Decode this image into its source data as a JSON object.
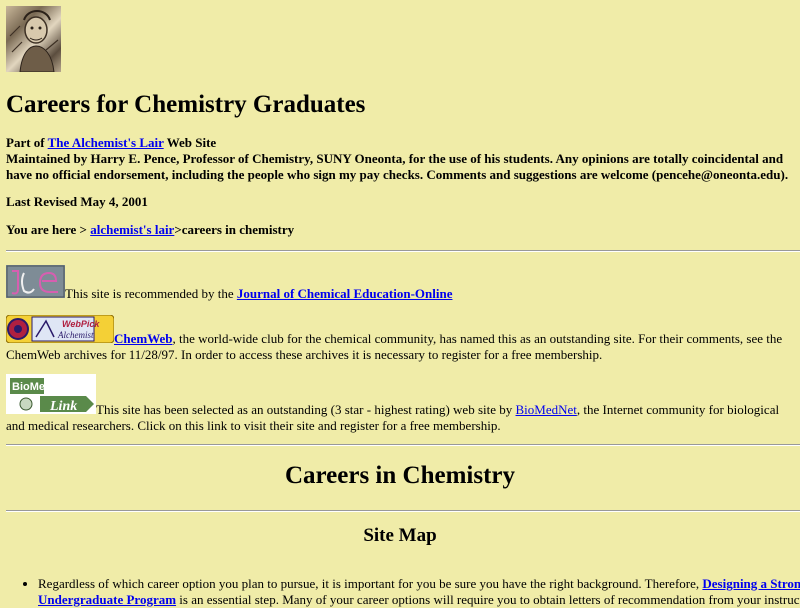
{
  "page": {
    "title": "Careers for Chemistry Graduates",
    "part_of_prefix": "Part of ",
    "site_link": "The Alchemist's Lair",
    "part_of_suffix": " Web Site",
    "maintained_by": "Maintained by Harry E. Pence, Professor of Chemistry, SUNY Oneonta, for the use of his students. Any opinions are totally coincidental and have no official endorsement, including the people who sign my pay checks. Comments and suggestions are welcome (pencehe@oneonta.edu).",
    "last_revised": "Last Revised May 4, 2001",
    "breadcrumb_prefix": "You are here > ",
    "breadcrumb_link": "alchemist's lair",
    "breadcrumb_suffix": ">careers in chemistry"
  },
  "recommendations": {
    "jce_text": "This site is recommended by the ",
    "jce_link": "Journal of Chemical Education-Online",
    "jce_badge": "JCE",
    "chemweb_badge_left": "WebPick",
    "chemweb_badge_right": "Alchemist",
    "chemweb_link": "ChemWeb",
    "chemweb_text": ", the world-wide club for the chemical community, has named this as an outstanding site. For their comments, see the ChemWeb archives for 11/28/97. In order to access these archives it is necessary to register for a free membership.",
    "biomed_badge_top": "BioMed",
    "biomed_badge_bottom": "Link",
    "biomed_text_pre": "This site has been selected as an outstanding (3 star - highest rating) web site by ",
    "biomed_link": "BioMedNet",
    "biomed_text_post": ", the Internet community for biological and medical researchers. Click on this link to visit their site and register for a free membership."
  },
  "main": {
    "heading": "Careers in Chemistry",
    "site_map": "Site Map",
    "bullet1_pre": "Regardless of which career option you plan to pursue, it is important for you be sure you have the right background. Therefore, ",
    "bullet1_link": "Designing a Strong Undergraduate Program",
    "bullet1_post": " is an essential step. Many of your career options will require you to obtain letters of recommendation from your instructors."
  }
}
